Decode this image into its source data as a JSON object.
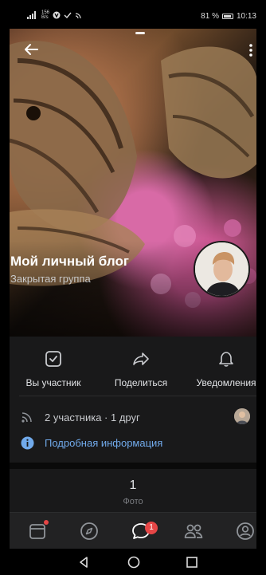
{
  "status_bar": {
    "signal_text": "⁴⁶",
    "data_rate": "156",
    "data_unit": "B/s",
    "battery": "81 %",
    "time": "10:13"
  },
  "group": {
    "title": "Мой личный блог",
    "subtitle": "Закрытая группа"
  },
  "actions": [
    {
      "label": "Вы участник",
      "icon": "checkbox-icon"
    },
    {
      "label": "Поделиться",
      "icon": "share-icon"
    },
    {
      "label": "Уведомления",
      "icon": "bell-icon"
    }
  ],
  "members": {
    "text": "2 участника · 1 друг"
  },
  "info": {
    "text": "Подробная информация"
  },
  "photos": {
    "count": "1",
    "label": "Фото"
  },
  "tabbar": {
    "messages_badge": "1"
  },
  "colors": {
    "accent": "#71aaeb",
    "badge": "#e64646",
    "panel": "#19191a"
  }
}
